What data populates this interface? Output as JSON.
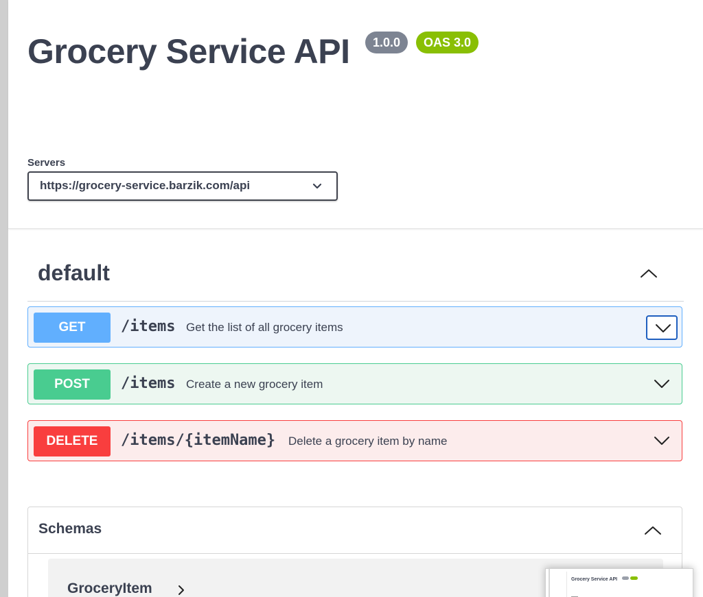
{
  "header": {
    "title": "Grocery Service API",
    "version_badge": "1.0.0",
    "oas_badge": "OAS 3.0"
  },
  "servers": {
    "label": "Servers",
    "selected": "https://grocery-service.barzik.com/api"
  },
  "section": {
    "title": "default",
    "toggle_icon": "chevron-up-icon"
  },
  "operations": [
    {
      "method": "GET",
      "path": "/items",
      "summary": "Get the list of all grocery items",
      "color": "#61affe"
    },
    {
      "method": "POST",
      "path": "/items",
      "summary": "Create a new grocery item",
      "color": "#49cc90"
    },
    {
      "method": "DELETE",
      "path": "/items/{itemName}",
      "summary": "Delete a grocery item by name",
      "color": "#f93e3e"
    }
  ],
  "schemas": {
    "title": "Schemas",
    "models": [
      {
        "name": "GroceryItem"
      }
    ]
  },
  "thumbnail": {
    "title": "Grocery Service API"
  },
  "colors": {
    "text": "#3b4151",
    "badge_version": "#7d8492",
    "badge_oas": "#89bf04"
  }
}
